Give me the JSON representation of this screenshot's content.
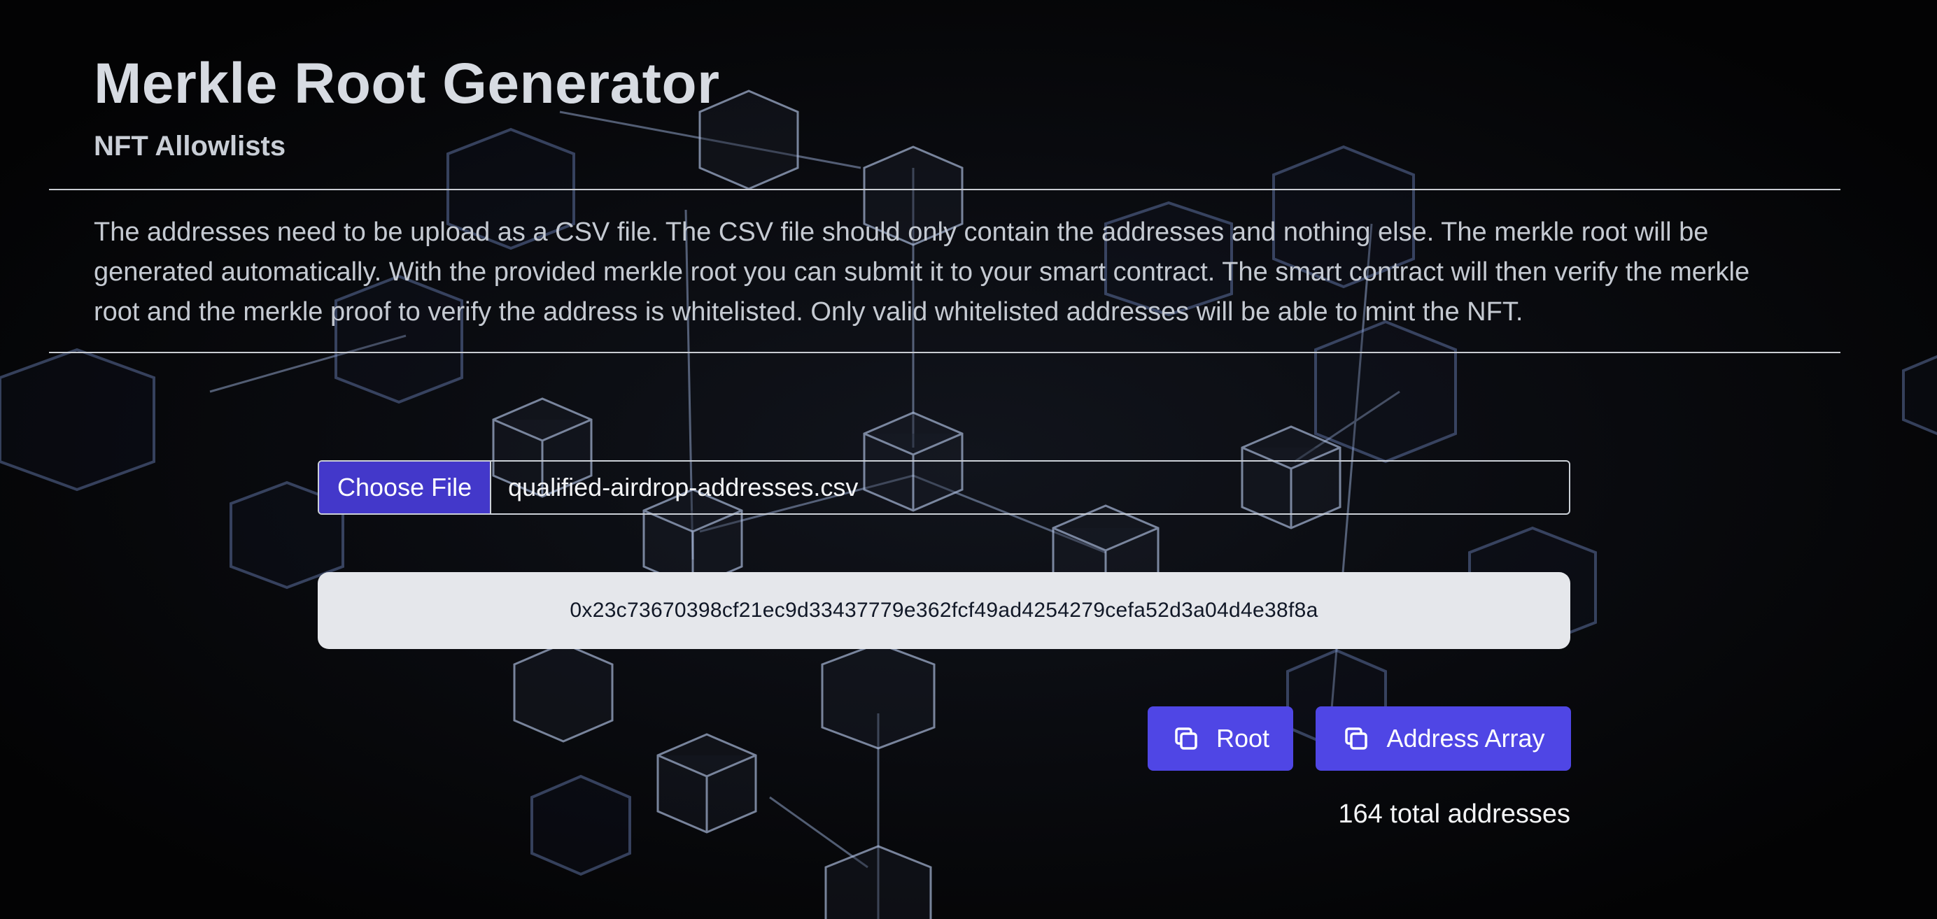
{
  "header": {
    "title": "Merkle Root Generator",
    "subtitle": "NFT Allowlists"
  },
  "description": "The addresses need to be upload as a CSV file. The CSV file should only contain the addresses and nothing else. The merkle root will be generated automatically. With the provided merkle root you can submit it to your smart contract. The smart contract will then verify the merkle root and the merkle proof to verify the address is whitelisted. Only valid whitelisted addresses will be able to mint the NFT.",
  "file_input": {
    "button_label": "Choose File",
    "file_name": "qualified-airdrop-addresses.csv"
  },
  "merkle_root": "0x23c73670398cf21ec9d33437779e362fcf49ad4254279cefa52d3a04d4e38f8a",
  "actions": {
    "copy_root_label": "Root",
    "copy_address_array_label": "Address Array",
    "copy_icon": "copy-icon"
  },
  "address_count_text": "164 total addresses",
  "colors": {
    "accent": "#4f46e5",
    "file_button": "#4338ca",
    "root_box": "#e5e7eb",
    "background": "#050507"
  }
}
